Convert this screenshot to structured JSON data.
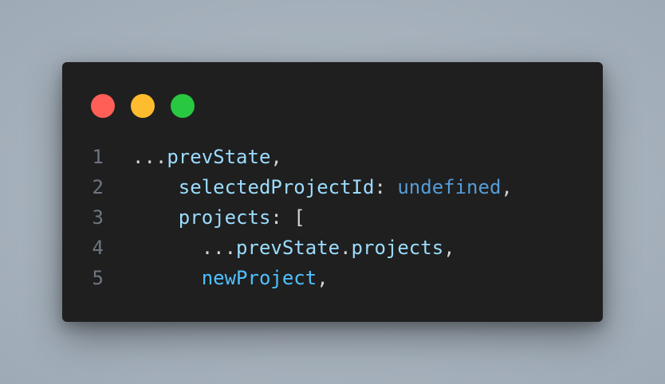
{
  "window": {
    "traffic_lights": [
      {
        "name": "close",
        "color": "#ff5f57"
      },
      {
        "name": "minimize",
        "color": "#febc2e"
      },
      {
        "name": "maximize",
        "color": "#28c840"
      }
    ]
  },
  "code": {
    "lines": [
      {
        "number": "1",
        "tokens": [
          {
            "text": "...",
            "class": "t-plain"
          },
          {
            "text": "prevState",
            "class": "t-var"
          },
          {
            "text": ",",
            "class": "t-plain"
          }
        ]
      },
      {
        "number": "2",
        "tokens": [
          {
            "text": "    ",
            "class": "t-plain"
          },
          {
            "text": "selectedProjectId",
            "class": "t-var"
          },
          {
            "text": ": ",
            "class": "t-plain"
          },
          {
            "text": "undefined",
            "class": "t-const"
          },
          {
            "text": ",",
            "class": "t-plain"
          }
        ]
      },
      {
        "number": "3",
        "tokens": [
          {
            "text": "    ",
            "class": "t-plain"
          },
          {
            "text": "projects",
            "class": "t-var"
          },
          {
            "text": ": [",
            "class": "t-plain"
          }
        ]
      },
      {
        "number": "4",
        "tokens": [
          {
            "text": "      ...",
            "class": "t-plain"
          },
          {
            "text": "prevState",
            "class": "t-var"
          },
          {
            "text": ".",
            "class": "t-plain"
          },
          {
            "text": "projects",
            "class": "t-var"
          },
          {
            "text": ",",
            "class": "t-plain"
          }
        ]
      },
      {
        "number": "5",
        "tokens": [
          {
            "text": "      ",
            "class": "t-plain"
          },
          {
            "text": "newProject",
            "class": "t-new"
          },
          {
            "text": ",",
            "class": "t-plain"
          }
        ]
      }
    ]
  }
}
